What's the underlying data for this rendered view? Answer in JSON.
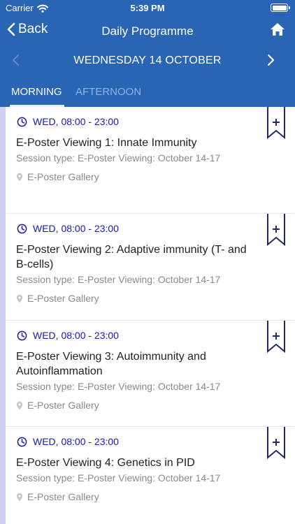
{
  "status_bar": {
    "carrier": "Carrier",
    "time": "5:39 PM"
  },
  "nav": {
    "back_label": "Back",
    "title": "Daily Programme"
  },
  "date_nav": {
    "label": "WEDNESDAY 14 OCTOBER"
  },
  "tabs": [
    {
      "label": "MORNING",
      "active": true
    },
    {
      "label": "AFTERNOON",
      "active": false
    }
  ],
  "colors": {
    "header": "#2a65b4",
    "time_text": "#1a1aa8",
    "accent_bar": "#cfd0f5"
  },
  "sessions": [
    {
      "time": "WED, 08:00 - 23:00",
      "title": "E-Poster Viewing 1: Innate Immunity",
      "type": "Session type: E-Poster Viewing: October 14-17",
      "location": "E-Poster Gallery"
    },
    {
      "time": "WED, 08:00 - 23:00",
      "title": "E-Poster Viewing 2: Adaptive immunity (T- and B-cells)",
      "type": "Session type: E-Poster Viewing: October 14-17",
      "location": "E-Poster Gallery"
    },
    {
      "time": "WED, 08:00 - 23:00",
      "title": "E-Poster Viewing 3: Autoimmunity and Autoinflammation",
      "type": "Session type: E-Poster Viewing: October 14-17",
      "location": "E-Poster Gallery"
    },
    {
      "time": "WED, 08:00 - 23:00",
      "title": "E-Poster Viewing 4: Genetics in PID",
      "type": "Session type: E-Poster Viewing: October 14-17",
      "location": "E-Poster Gallery"
    }
  ]
}
